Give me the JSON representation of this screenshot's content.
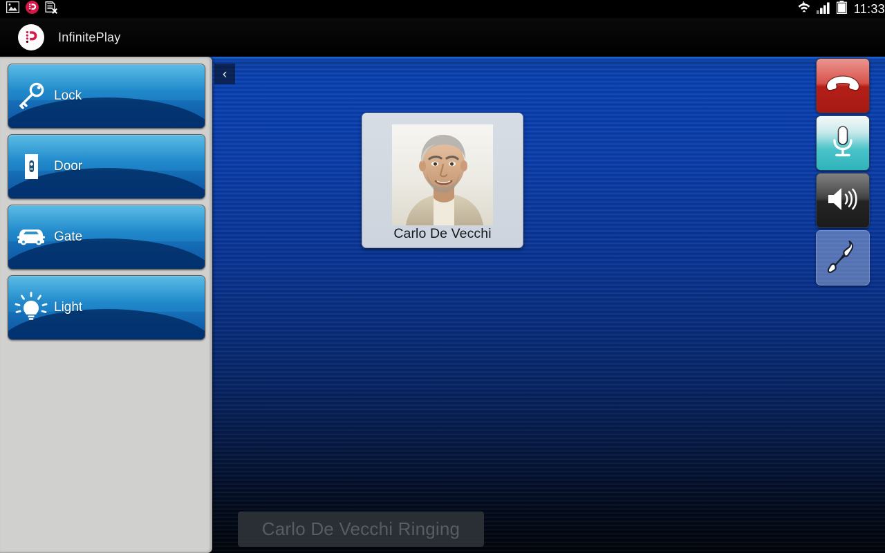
{
  "statusbar": {
    "time": "11:33",
    "left_icons": [
      {
        "name": "gallery-image-icon"
      },
      {
        "name": "infiniteplay-notification-icon"
      },
      {
        "name": "sd-card-removed-icon"
      }
    ],
    "right_icons": [
      {
        "name": "wifi-icon"
      },
      {
        "name": "cellular-signal-icon"
      },
      {
        "name": "battery-icon"
      }
    ]
  },
  "appbar": {
    "title": "InfinitePlay",
    "logo_icon": "infiniteplay-logo-icon",
    "logo_color": "#d6174a"
  },
  "sidebar": {
    "items": [
      {
        "label": "Lock",
        "icon": "key-icon"
      },
      {
        "label": "Door",
        "icon": "door-icon"
      },
      {
        "label": "Gate",
        "icon": "car-icon"
      },
      {
        "label": "Light",
        "icon": "lightbulb-icon"
      }
    ]
  },
  "stage": {
    "back_button": {
      "label": "‹",
      "icon": "chevron-left-icon"
    },
    "contact": {
      "name": "Carlo De Vecchi",
      "photo_alt": "contact-photo"
    }
  },
  "call_controls": [
    {
      "name": "hangup-button",
      "icon": "phone-hangup-icon",
      "color": "#b31f18",
      "state": "enabled"
    },
    {
      "name": "microphone-button",
      "icon": "microphone-icon",
      "color": "#2fb3ba",
      "state": "enabled"
    },
    {
      "name": "speaker-button",
      "icon": "speaker-icon",
      "color": "#1b1b1b",
      "state": "enabled"
    },
    {
      "name": "answer-button",
      "icon": "phone-handset-icon",
      "color": "#bccde6",
      "state": "disabled"
    }
  ],
  "toast": {
    "message": "Carlo De Vecchi Ringing"
  }
}
